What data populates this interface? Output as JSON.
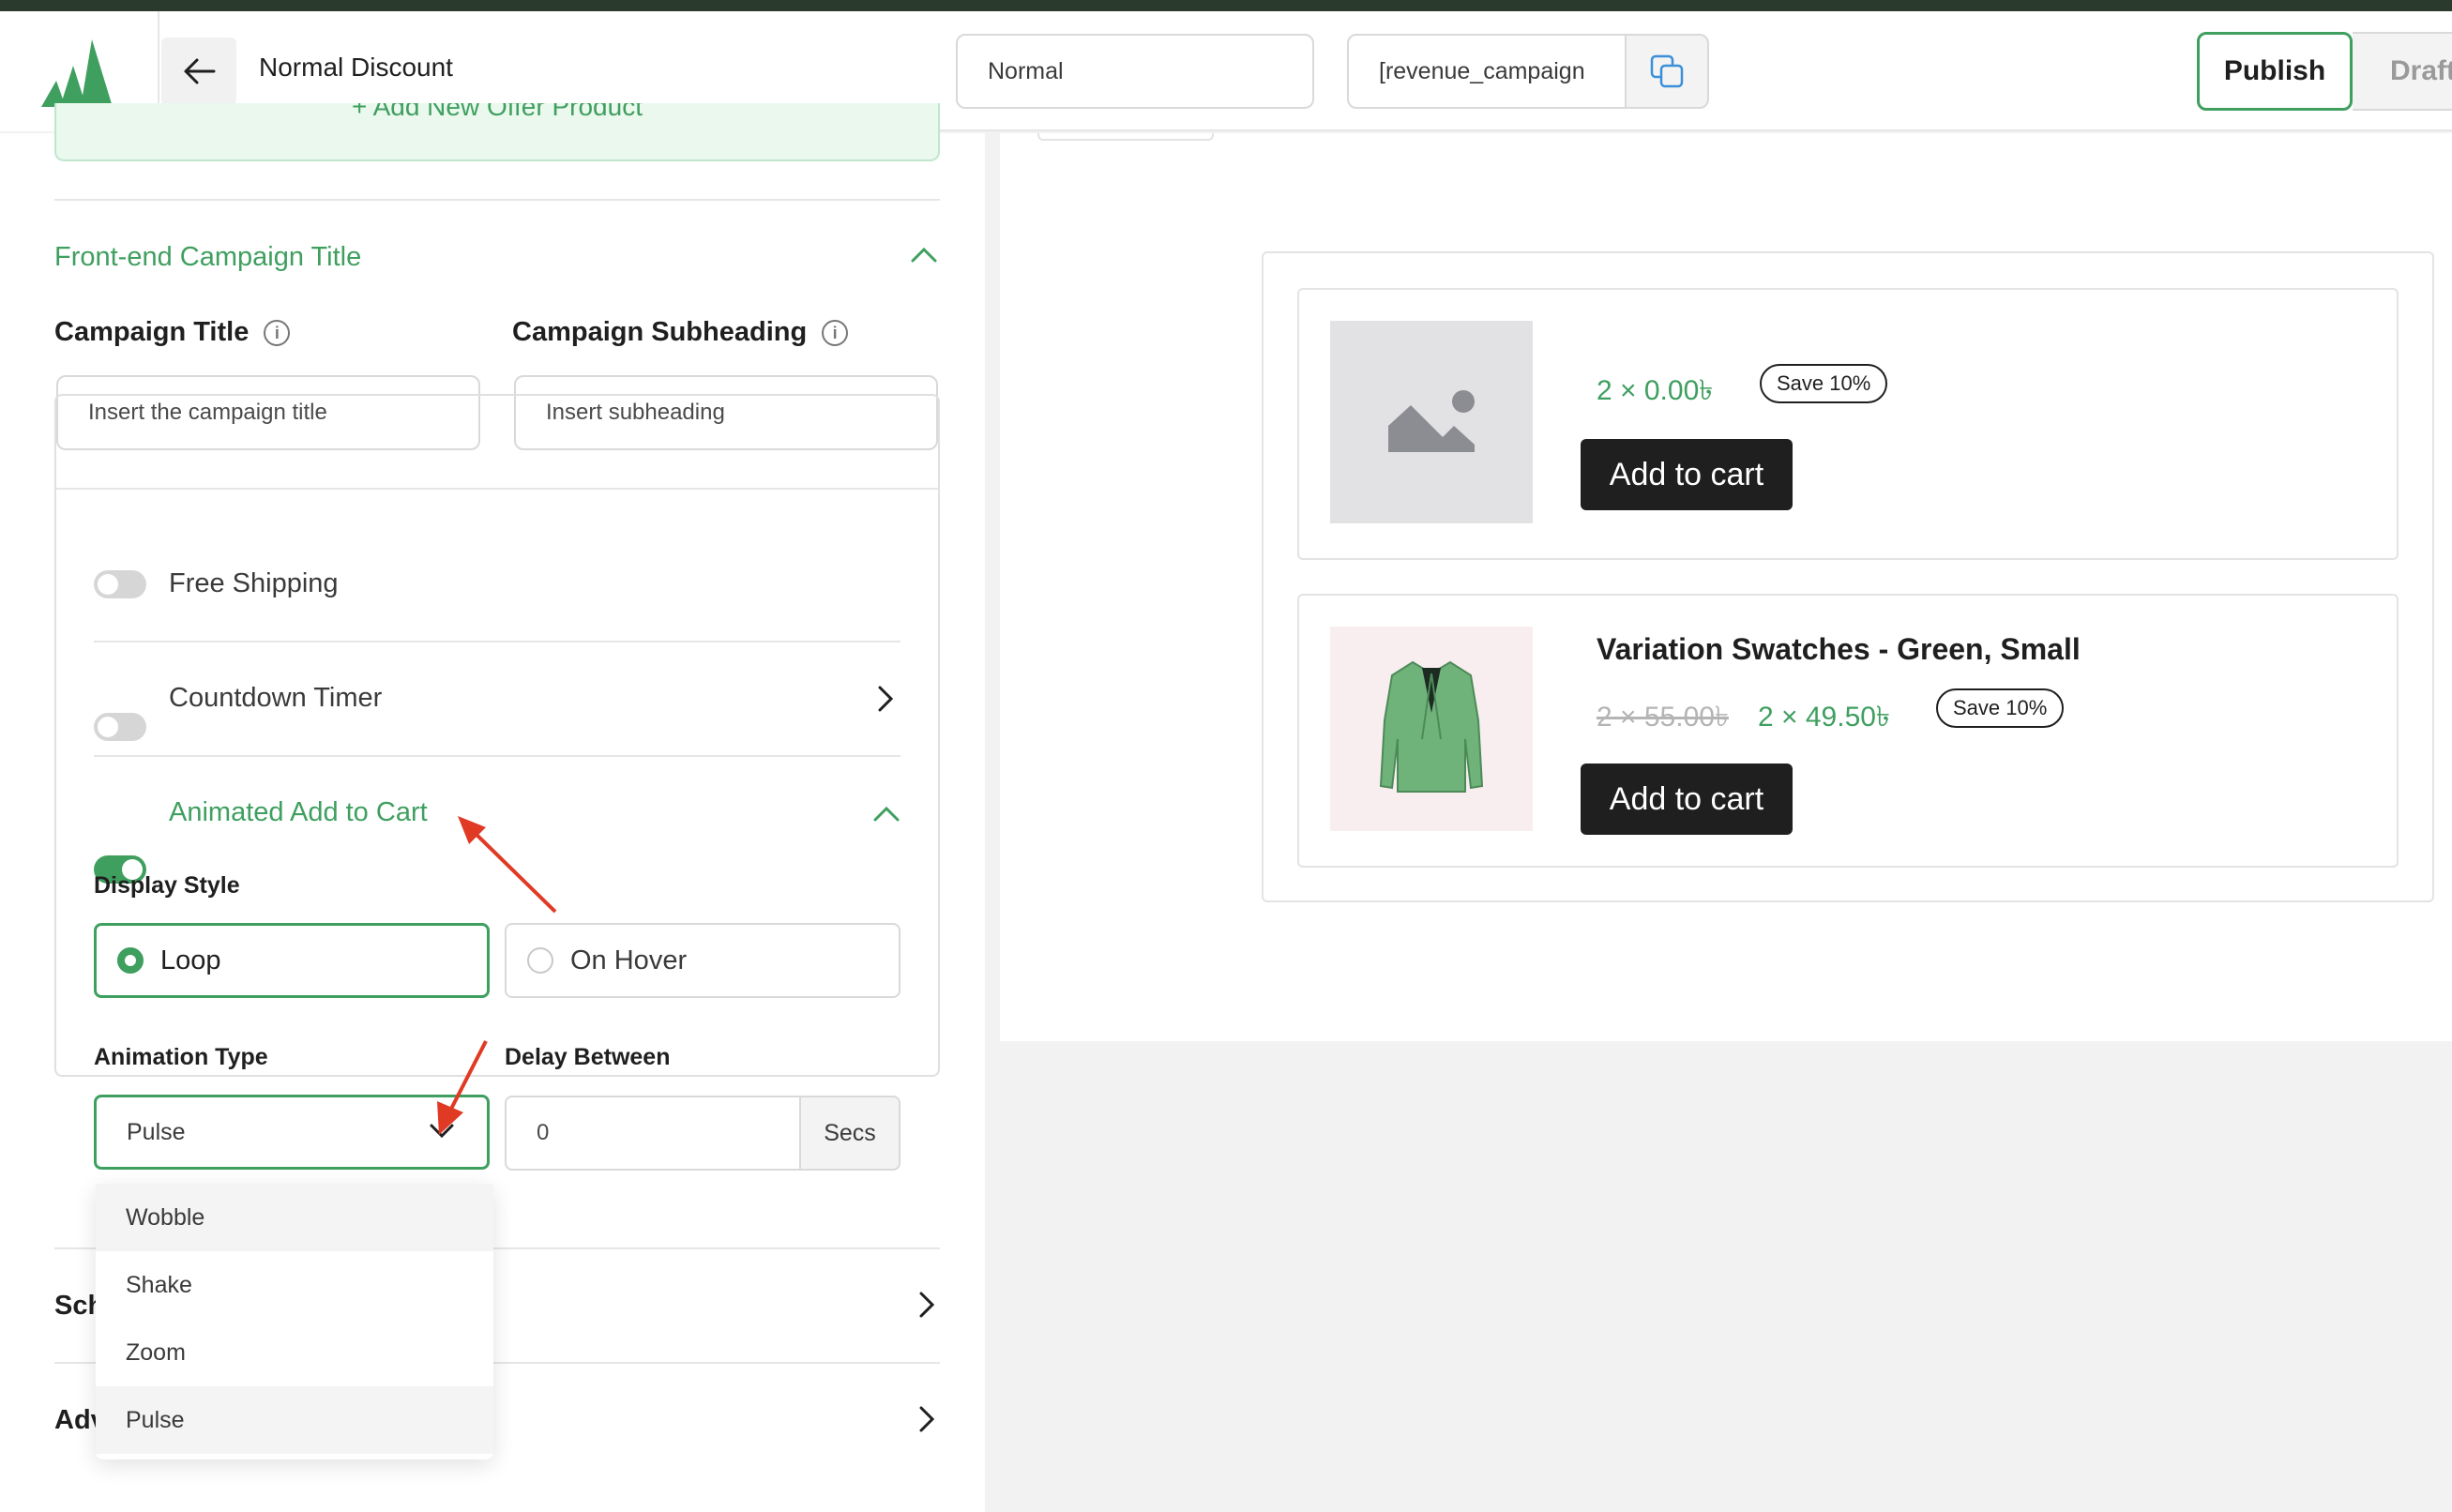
{
  "header": {
    "title": "Normal Discount",
    "mode": "Normal",
    "shortcode": "[revenue_campaign",
    "publish_label": "Publish",
    "draft_label": "Draft"
  },
  "left": {
    "add_offer_label": "+ Add New Offer Product",
    "frontend_section_title": "Front-end Campaign Title",
    "campaign_title_label": "Campaign Title",
    "campaign_subheading_label": "Campaign Subheading",
    "campaign_title_placeholder": "Insert the campaign title",
    "campaign_subheading_placeholder": "Insert subheading",
    "features": {
      "free_shipping": "Free Shipping",
      "countdown_timer": "Countdown Timer",
      "animated_add_to_cart": "Animated Add to Cart"
    },
    "display_style_label": "Display Style",
    "display_options": [
      "Loop",
      "On Hover"
    ],
    "animation_type_label": "Animation Type",
    "animation_type_value": "Pulse",
    "delay_label": "Delay Between",
    "delay_value": "0",
    "delay_unit": "Secs",
    "dropdown_options": [
      "Wobble",
      "Shake",
      "Zoom",
      "Pulse"
    ],
    "collapsed_sections": [
      "Sch",
      "Adv"
    ]
  },
  "preview": {
    "product1": {
      "price": "2 × 0.00৳",
      "save_badge": "Save 10%",
      "cart_label": "Add to cart"
    },
    "product2": {
      "name": "Variation Swatches - Green, Small",
      "old_price": "2 × 55.00৳",
      "price": "2 × 49.50৳",
      "save_badge": "Save 10%",
      "cart_label": "Add to cart"
    }
  },
  "colors": {
    "accent": "#3f9f5f",
    "dark": "#1f1f1f",
    "annotation_arrow": "#e03a25"
  }
}
